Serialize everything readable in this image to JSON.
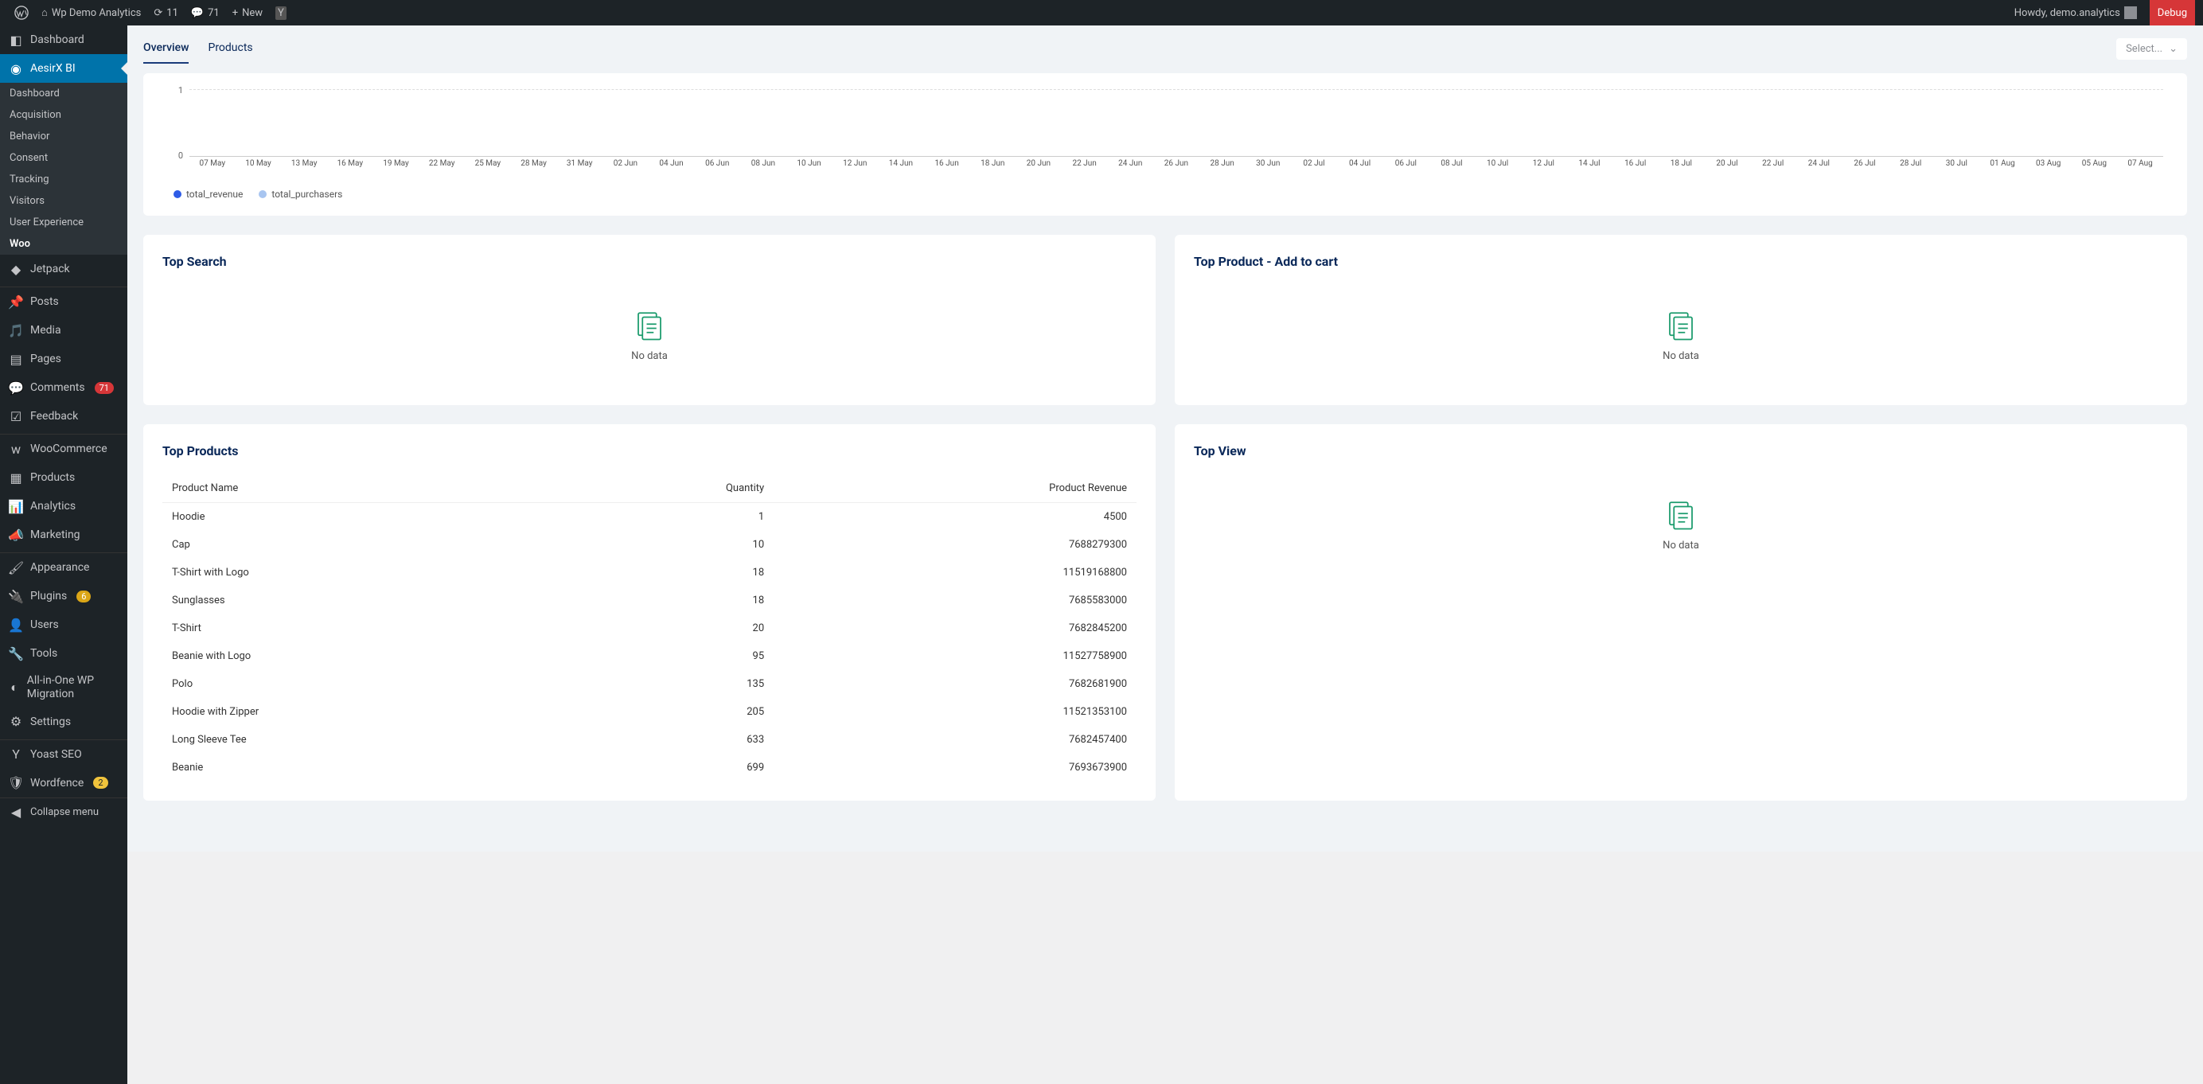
{
  "admin_bar": {
    "site_name": "Wp Demo Analytics",
    "updates": "11",
    "comments": "71",
    "new_label": "New",
    "howdy": "Howdy, demo.analytics",
    "debug": "Debug"
  },
  "sidebar": {
    "dashboard": "Dashboard",
    "aesirx": "AesirX BI",
    "sub": {
      "dashboard": "Dashboard",
      "acquisition": "Acquisition",
      "behavior": "Behavior",
      "consent": "Consent",
      "tracking": "Tracking",
      "visitors": "Visitors",
      "ux": "User Experience",
      "woo": "Woo"
    },
    "jetpack": "Jetpack",
    "posts": "Posts",
    "media": "Media",
    "pages": "Pages",
    "comments": "Comments",
    "comments_badge": "71",
    "feedback": "Feedback",
    "woocommerce": "WooCommerce",
    "products": "Products",
    "analytics": "Analytics",
    "marketing": "Marketing",
    "appearance": "Appearance",
    "plugins": "Plugins",
    "plugins_badge": "6",
    "users": "Users",
    "tools": "Tools",
    "aio": "All-in-One WP Migration",
    "settings": "Settings",
    "yoast": "Yoast SEO",
    "wordfence": "Wordfence",
    "wordfence_badge": "2",
    "collapse": "Collapse menu"
  },
  "tabs": {
    "overview": "Overview",
    "products": "Products",
    "select_placeholder": "Select..."
  },
  "chart_data": {
    "type": "line",
    "title": "",
    "ylim": [
      0,
      1
    ],
    "y_ticks": [
      "0",
      "1"
    ],
    "x_ticks": [
      "07 May",
      "10 May",
      "13 May",
      "16 May",
      "19 May",
      "22 May",
      "25 May",
      "28 May",
      "31 May",
      "02 Jun",
      "04 Jun",
      "06 Jun",
      "08 Jun",
      "10 Jun",
      "12 Jun",
      "14 Jun",
      "16 Jun",
      "18 Jun",
      "20 Jun",
      "22 Jun",
      "24 Jun",
      "26 Jun",
      "28 Jun",
      "30 Jun",
      "02 Jul",
      "04 Jul",
      "06 Jul",
      "08 Jul",
      "10 Jul",
      "12 Jul",
      "14 Jul",
      "16 Jul",
      "18 Jul",
      "20 Jul",
      "22 Jul",
      "24 Jul",
      "26 Jul",
      "28 Jul",
      "30 Jul",
      "01 Aug",
      "03 Aug",
      "05 Aug",
      "07 Aug"
    ],
    "series": [
      {
        "name": "total_revenue",
        "color": "#2e5ce6",
        "values": []
      },
      {
        "name": "total_purchasers",
        "color": "#a8c5f0",
        "values": []
      }
    ]
  },
  "panels": {
    "top_search": {
      "title": "Top Search",
      "nodata": "No data"
    },
    "top_addcart": {
      "title": "Top Product - Add to cart",
      "nodata": "No data"
    },
    "top_view": {
      "title": "Top View",
      "nodata": "No data"
    },
    "top_products": {
      "title": "Top Products",
      "columns": {
        "name": "Product Name",
        "qty": "Quantity",
        "rev": "Product Revenue"
      },
      "rows": [
        {
          "name": "Hoodie",
          "qty": "1",
          "rev": "4500"
        },
        {
          "name": "Cap",
          "qty": "10",
          "rev": "7688279300"
        },
        {
          "name": "T-Shirt with Logo",
          "qty": "18",
          "rev": "11519168800"
        },
        {
          "name": "Sunglasses",
          "qty": "18",
          "rev": "7685583000"
        },
        {
          "name": "T-Shirt",
          "qty": "20",
          "rev": "7682845200"
        },
        {
          "name": "Beanie with Logo",
          "qty": "95",
          "rev": "11527758900"
        },
        {
          "name": "Polo",
          "qty": "135",
          "rev": "7682681900"
        },
        {
          "name": "Hoodie with Zipper",
          "qty": "205",
          "rev": "11521353100"
        },
        {
          "name": "Long Sleeve Tee",
          "qty": "633",
          "rev": "7682457400"
        },
        {
          "name": "Beanie",
          "qty": "699",
          "rev": "7693673900"
        }
      ]
    }
  }
}
